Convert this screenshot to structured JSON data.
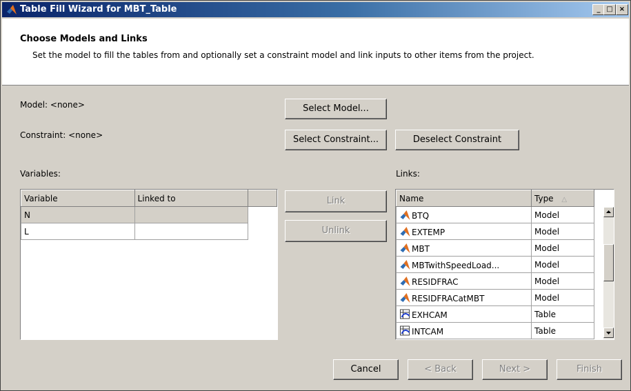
{
  "window": {
    "title": "Table Fill Wizard for MBT_Table",
    "minimize": "_",
    "maximize": "□",
    "close": "×"
  },
  "header": {
    "title": "Choose Models and Links",
    "description": "Set the model to fill the tables from and optionally set a constraint model and link inputs to other items from the project."
  },
  "model": {
    "label": "Model: <none>",
    "select_button": "Select Model..."
  },
  "constraint": {
    "label": "Constraint: <none>",
    "select_button": "Select Constraint...",
    "deselect_button": "Deselect Constraint"
  },
  "variables": {
    "label": "Variables:",
    "columns": [
      "Variable",
      "Linked to"
    ],
    "rows": [
      {
        "variable": "N",
        "linked_to": ""
      },
      {
        "variable": "L",
        "linked_to": ""
      }
    ]
  },
  "actions": {
    "link": "Link",
    "unlink": "Unlink"
  },
  "links": {
    "label": "Links:",
    "columns": [
      "Name",
      "Type"
    ],
    "sort_indicator": "△",
    "rows": [
      {
        "name": "BTQ",
        "type": "Model",
        "icon": "model-icon"
      },
      {
        "name": "EXTEMP",
        "type": "Model",
        "icon": "model-icon"
      },
      {
        "name": "MBT",
        "type": "Model",
        "icon": "model-icon"
      },
      {
        "name": "MBTwithSpeedLoad...",
        "type": "Model",
        "icon": "model-icon"
      },
      {
        "name": "RESIDFRAC",
        "type": "Model",
        "icon": "model-icon"
      },
      {
        "name": "RESIDFRACatMBT",
        "type": "Model",
        "icon": "model-icon"
      },
      {
        "name": "EXHCAM",
        "type": "Table",
        "icon": "table-icon"
      },
      {
        "name": "INTCAM",
        "type": "Table",
        "icon": "table-icon"
      }
    ]
  },
  "footer": {
    "cancel": "Cancel",
    "back": "< Back",
    "next": "Next >",
    "finish": "Finish"
  }
}
